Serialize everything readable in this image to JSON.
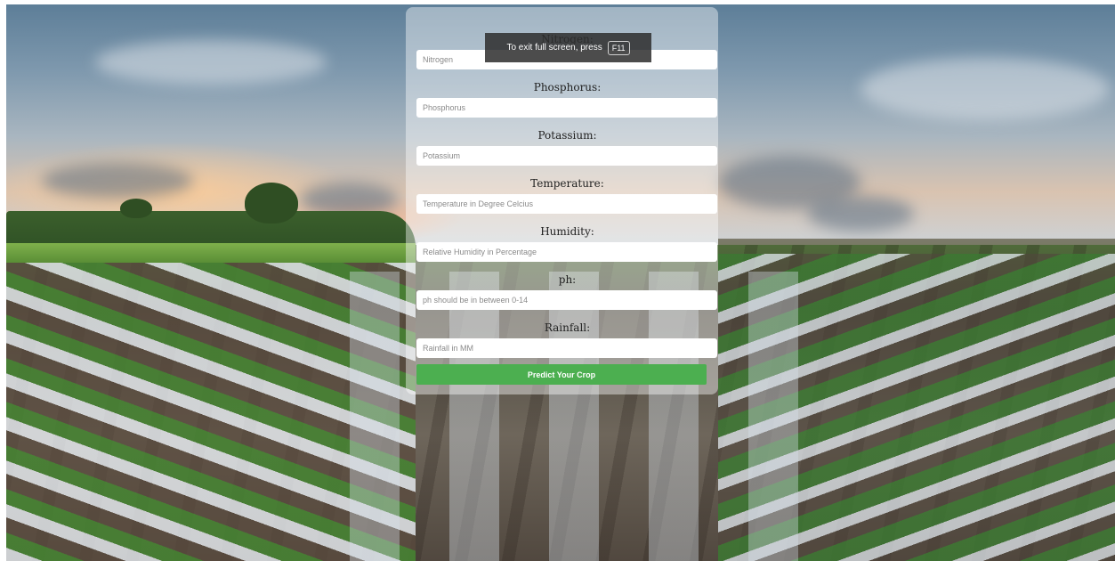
{
  "notice": {
    "text": "To exit full screen, press",
    "key": "F11"
  },
  "form": {
    "fields": [
      {
        "label": "Nitrogen:",
        "placeholder": "Nitrogen"
      },
      {
        "label": "Phosphorus:",
        "placeholder": "Phosphorus"
      },
      {
        "label": "Potassium:",
        "placeholder": "Potassium"
      },
      {
        "label": "Temperature:",
        "placeholder": "Temperature in Degree Celcius"
      },
      {
        "label": "Humidity:",
        "placeholder": "Relative Humidity in Percentage"
      },
      {
        "label": "ph:",
        "placeholder": "ph should be in between 0-14"
      },
      {
        "label": "Rainfall:",
        "placeholder": "Rainfall in MM"
      }
    ],
    "submit_label": "Predict Your Crop"
  },
  "colors": {
    "submit_button": "#4caf50",
    "panel_background": "rgba(255,255,255,0.42)"
  }
}
